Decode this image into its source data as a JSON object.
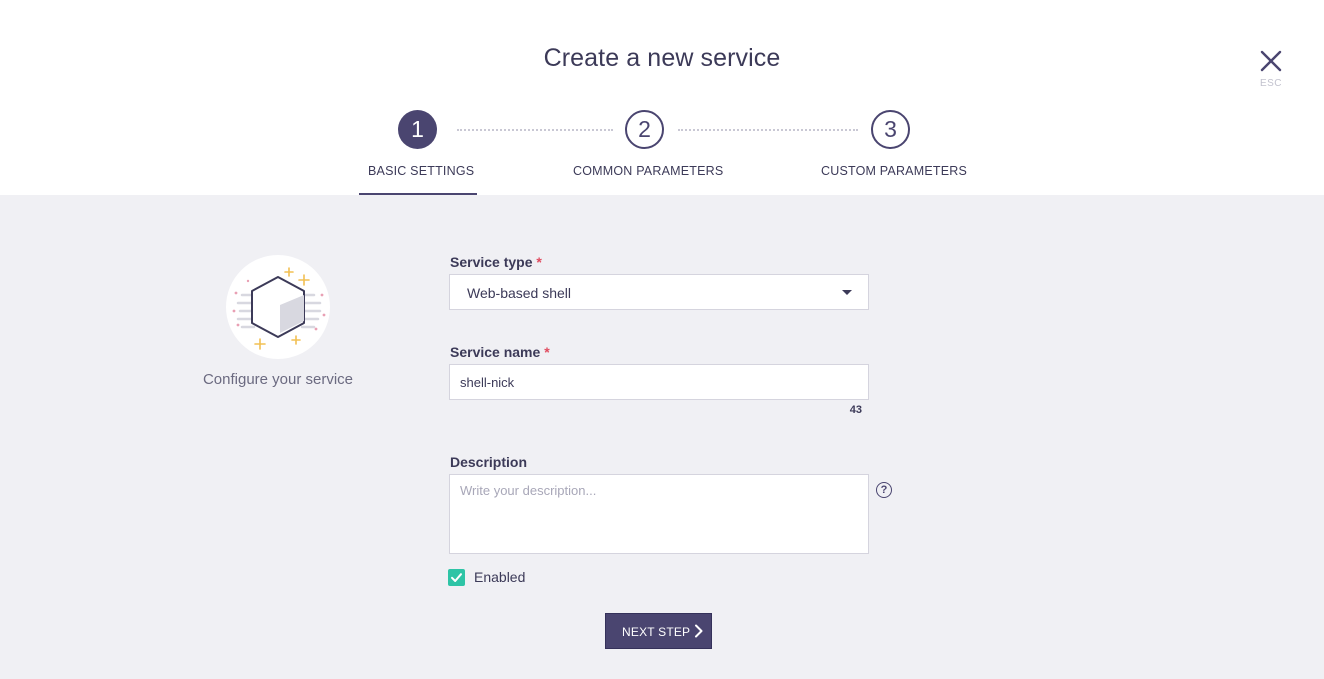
{
  "header": {
    "title": "Create a new service",
    "close_hint": "ESC"
  },
  "steps": [
    {
      "number": "1",
      "label": "BASIC SETTINGS",
      "active": true
    },
    {
      "number": "2",
      "label": "COMMON PARAMETERS",
      "active": false
    },
    {
      "number": "3",
      "label": "CUSTOM PARAMETERS",
      "active": false
    }
  ],
  "illustration": {
    "icon": "cube-icon",
    "caption": "Configure your service"
  },
  "form": {
    "service_type": {
      "label": "Service type",
      "required_mark": "*",
      "value": "Web-based shell"
    },
    "service_name": {
      "label": "Service name",
      "required_mark": "*",
      "value": "shell-nick",
      "counter": "43"
    },
    "description": {
      "label": "Description",
      "value": "",
      "placeholder": "Write your description...",
      "help_icon": "?"
    },
    "enabled": {
      "label": "Enabled",
      "checked": true
    },
    "next_button": "NEXT STEP"
  },
  "colors": {
    "accent": "#4a4570",
    "background": "#f0f0f4",
    "required": "#e04b5f",
    "checkbox": "#2ec4a6"
  }
}
